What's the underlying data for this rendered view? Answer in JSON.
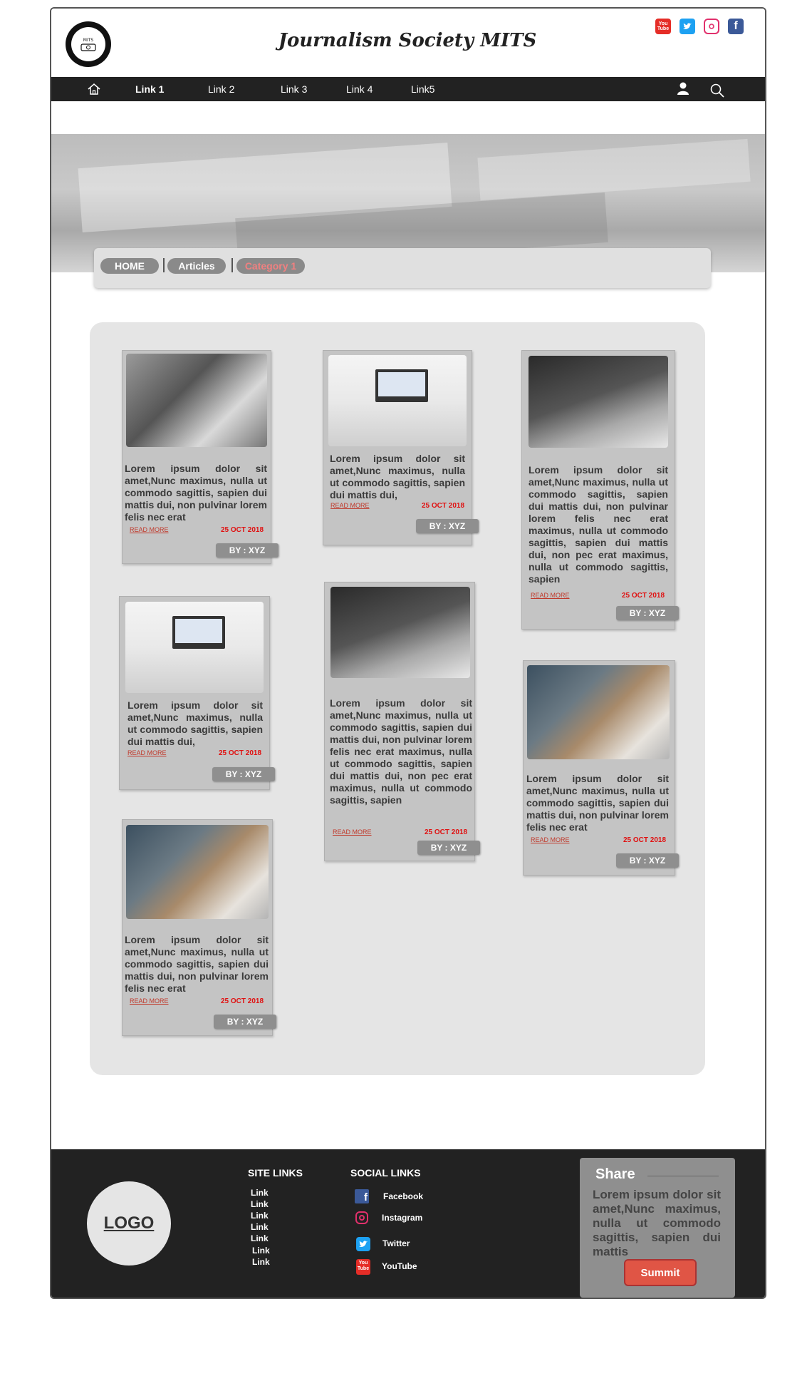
{
  "header": {
    "title": "Journalism Society MITS",
    "logo_text": "MITS",
    "social": [
      {
        "name": "YouTube",
        "label": "You Tube",
        "color": "#e52d27"
      },
      {
        "name": "Twitter",
        "label": "t",
        "color": "#1da1f2"
      },
      {
        "name": "Instagram",
        "label": "◎",
        "color": "#e1306c"
      },
      {
        "name": "Facebook",
        "label": "f",
        "color": "#3b5998"
      }
    ]
  },
  "nav": {
    "items": [
      "Link 1",
      "Link 2",
      "Link 3",
      "Link 4",
      "Link5"
    ]
  },
  "breadcrumb": {
    "items": [
      "HOME",
      "Articles",
      "Category 1"
    ]
  },
  "cards": {
    "text_short": "Lorem ipsum dolor sit amet,Nunc maximus, nulla ut commodo sagittis, sapien dui mattis dui,",
    "text_medium": "Lorem ipsum dolor sit amet,Nunc maximus, nulla ut commodo sagittis, sapien dui mattis dui, non pulvinar lorem felis nec erat",
    "text_long": "Lorem ipsum dolor sit amet,Nunc maximus, nulla ut commodo sagittis, sapien dui mattis dui, non pulvinar lorem felis nec erat maximus, nulla ut commodo sagittis, sapien dui mattis dui, non pec erat maximus, nulla ut commodo sagittis, sapien",
    "read_more": "READ MORE",
    "date": "25 OCT 2018",
    "by": "BY : XYZ"
  },
  "footer": {
    "logo": "LOGO",
    "site_links_title": "SITE LINKS",
    "site_links": [
      "Link",
      "Link",
      "Link",
      "Link",
      "Link",
      "Link",
      "Link"
    ],
    "social_links_title": "SOCIAL LINKS",
    "social_links": [
      "Facebook",
      "Instagram",
      "Twitter",
      "YouTube"
    ],
    "share": {
      "title": "Share",
      "text": "Lorem ipsum dolor sit amet,Nunc maximus, nulla ut commodo sagittis, sapien dui mattis",
      "button": "Summit"
    }
  }
}
